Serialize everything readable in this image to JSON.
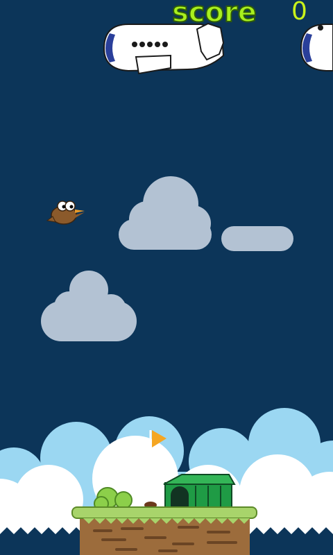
{
  "hud": {
    "score_label": "score",
    "score_value": "0"
  },
  "colors": {
    "sky": "#0c3559",
    "cloud": "#b3c2d3",
    "score_text": "#a8f01e",
    "ground_grass": "#a8d46b",
    "house": "#1f9b45",
    "flag": "#f5a623",
    "water": "#0c3559"
  },
  "scene": {
    "player": "brown-bird",
    "obstacles": [
      "airplane",
      "airplane"
    ],
    "clouds": 3,
    "landmarks": [
      "flag",
      "bush",
      "house",
      "floating-island"
    ]
  }
}
